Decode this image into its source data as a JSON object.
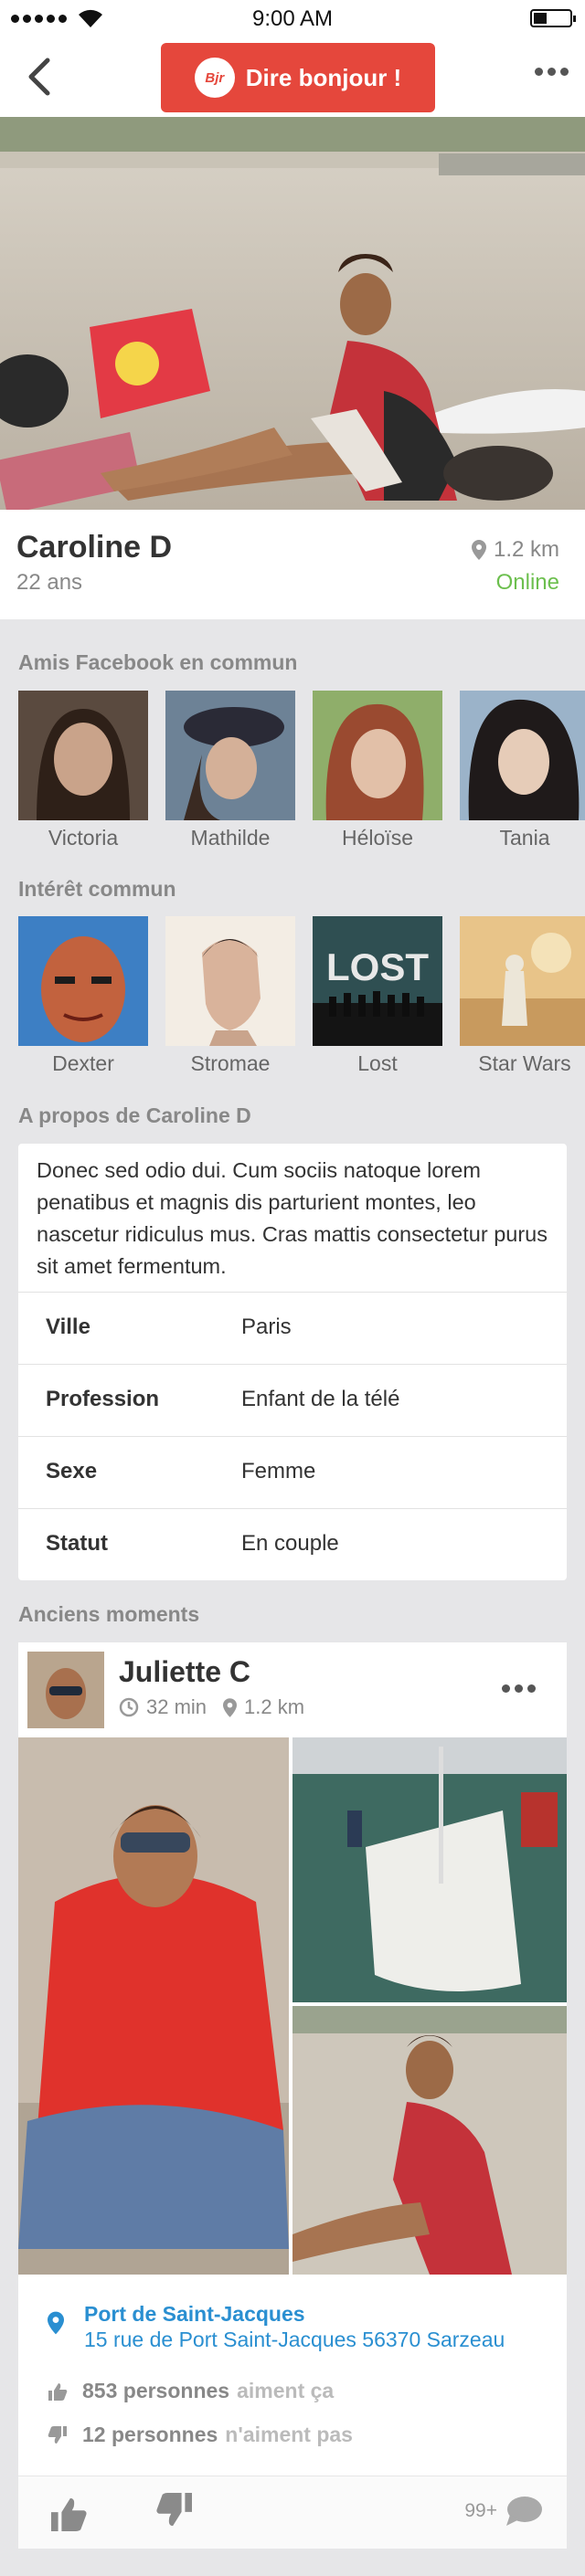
{
  "status_bar": {
    "time": "9:00 AM"
  },
  "navbar": {
    "hello_logo": "Bjr",
    "hello_label": "Dire bonjour !"
  },
  "profile": {
    "name": "Caroline D",
    "age": "22 ans",
    "distance": "1.2 km",
    "status": "Online",
    "status_color": "#6cbf4e"
  },
  "friends": {
    "title": "Amis Facebook en commun",
    "items": [
      {
        "label": "Victoria"
      },
      {
        "label": "Mathilde"
      },
      {
        "label": "Héloïse"
      },
      {
        "label": "Tania"
      }
    ]
  },
  "interests": {
    "title": "Intérêt commun",
    "items": [
      {
        "label": "Dexter"
      },
      {
        "label": "Stromae"
      },
      {
        "label": "Lost",
        "image_text": "LOST"
      },
      {
        "label": "Star Wars"
      }
    ]
  },
  "about": {
    "title": "A propos de Caroline D",
    "text": "Donec sed odio dui. Cum sociis natoque lorem penatibus et magnis dis parturient montes, leo nascetur ridiculus mus. Cras mattis consectetur purus sit amet fermentum.",
    "rows": [
      {
        "key": "Ville",
        "value": "Paris"
      },
      {
        "key": "Profession",
        "value": "Enfant de la télé"
      },
      {
        "key": "Sexe",
        "value": "Femme"
      },
      {
        "key": "Statut",
        "value": "En couple"
      }
    ]
  },
  "moments": {
    "title": "Anciens moments",
    "post": {
      "user": "Juliette C",
      "time": "32 min",
      "distance": "1.2 km",
      "place_name": "Port de Saint-Jacques",
      "place_address": "15 rue de Port Saint-Jacques 56370 Sarzeau",
      "likes_count": "853 personnes",
      "likes_text": "aiment ça",
      "dislikes_count": "12 personnes",
      "dislikes_text": "n'aiment pas",
      "comments": "99+"
    }
  },
  "colors": {
    "accent": "#e5473c",
    "link": "#2a8fd1",
    "background": "#e6e6e8"
  },
  "icons": [
    "back-arrow-icon",
    "more-dots-icon",
    "location-pin-icon",
    "clock-icon",
    "thumbs-up-icon",
    "thumbs-down-icon",
    "comment-bubble-icon"
  ]
}
